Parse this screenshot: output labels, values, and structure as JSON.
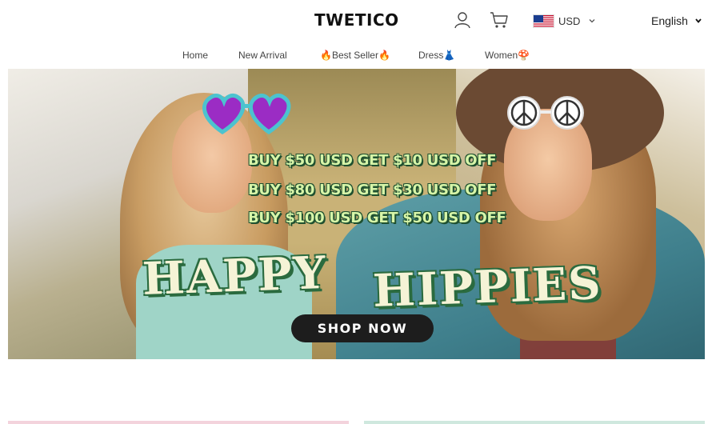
{
  "header": {
    "logo": "TWETICO",
    "icons": {
      "account": "user-icon",
      "cart": "cart-icon"
    },
    "currency": {
      "label": "USD",
      "flag": "us-flag-icon"
    },
    "language": {
      "label": "English"
    }
  },
  "nav": {
    "items": [
      {
        "label": "Home"
      },
      {
        "label": "New Arrival"
      },
      {
        "label": "🔥Best Seller🔥"
      },
      {
        "label": "Dress👗"
      },
      {
        "label": "Women🍄"
      }
    ]
  },
  "banner": {
    "promos": [
      "BUY $50 USD GET $10 USD OFF",
      "BUY $80 USD GET $30 USD OFF",
      "BUY $100 USD GET $50 USD OFF"
    ],
    "headline_left": "HAPPY",
    "headline_right": "HIPPIES",
    "cta": "SHOP NOW"
  },
  "colors": {
    "promo_text": "#d7f5a8",
    "headline_text": "#f5f3d6",
    "headline_outline": "#2b6b3f",
    "cta_background": "#1d1d1d",
    "card_left": "#f3d3dc",
    "card_right": "#cfe8de"
  }
}
